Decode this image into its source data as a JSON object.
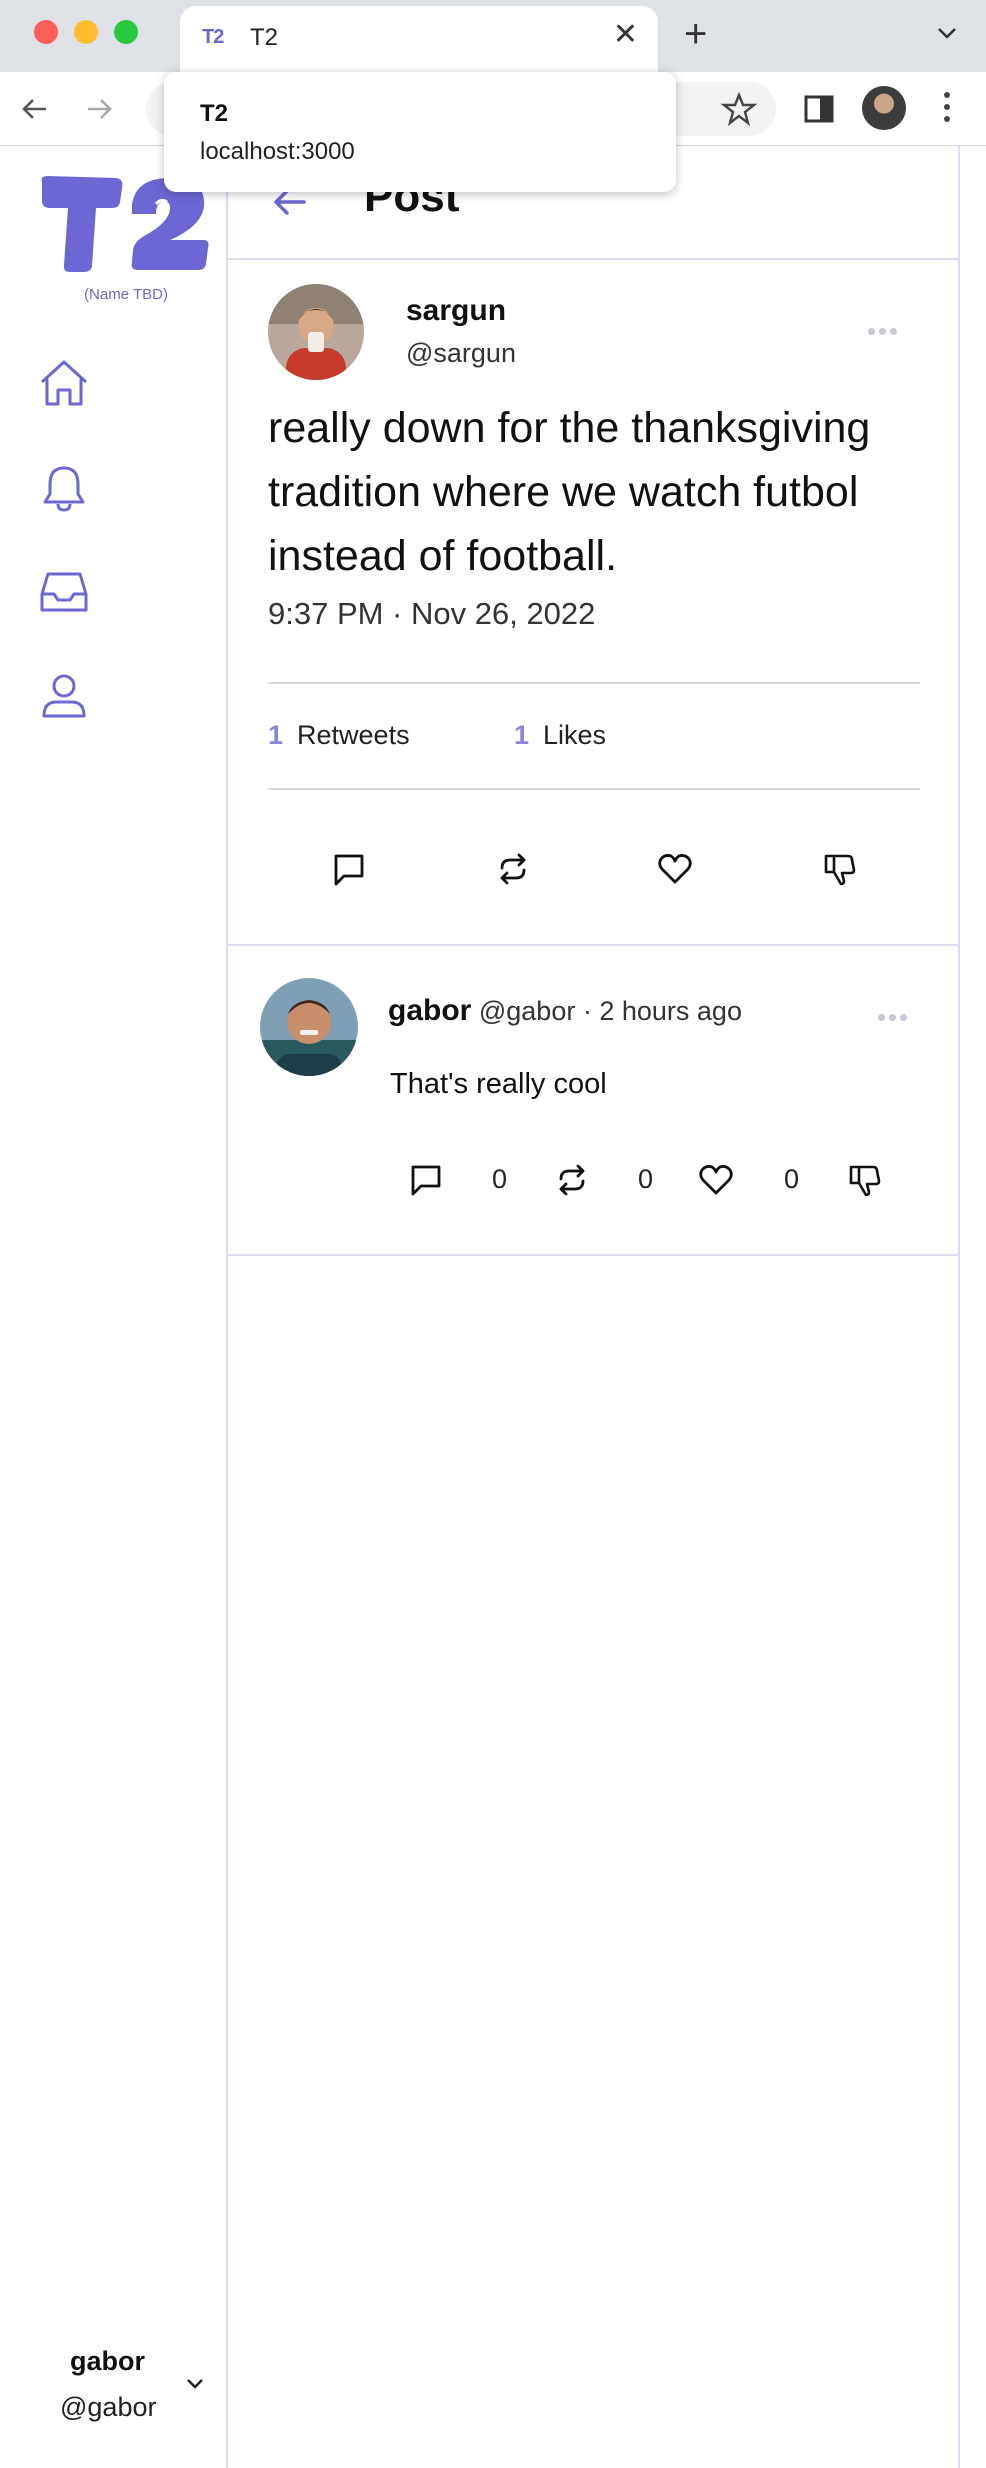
{
  "browser": {
    "tab_title": "T2",
    "tab_favicon": "T2",
    "tooltip_title": "T2",
    "tooltip_url": "localhost:3000"
  },
  "sidebar": {
    "logo_text": "T2",
    "logo_tagline": "(Name TBD)",
    "nav": [
      {
        "icon": "home-icon"
      },
      {
        "icon": "bell-icon"
      },
      {
        "icon": "inbox-icon"
      },
      {
        "icon": "profile-icon"
      }
    ],
    "user_name": "gabor",
    "user_handle": "@gabor"
  },
  "header": {
    "title": "Post"
  },
  "post": {
    "author_name": "sargun",
    "author_handle": "@sargun",
    "text": "really down for the thanksgiving tradition where we watch futbol instead of football.",
    "timestamp": "9:37 PM · Nov 26, 2022",
    "retweets_count": "1",
    "retweets_label": "Retweets",
    "likes_count": "1",
    "likes_label": "Likes"
  },
  "reply": {
    "author_name": "gabor",
    "author_handle": "@gabor",
    "separator": "·",
    "time_ago": "2 hours ago",
    "text": "That's really cool",
    "reply_count": "0",
    "retweet_count": "0",
    "like_count": "0"
  },
  "colors": {
    "accent": "#6d67d4",
    "divider": "#dcdcf0"
  }
}
